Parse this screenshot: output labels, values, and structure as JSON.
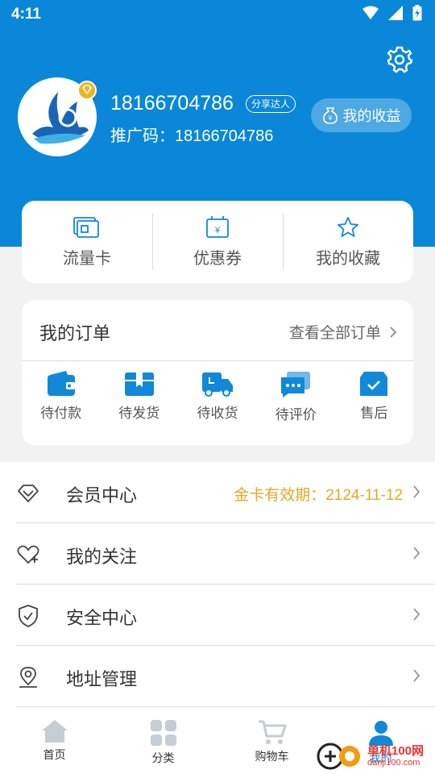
{
  "status": {
    "time": "4:11"
  },
  "profile": {
    "username": "18166704786",
    "badge": "分享达人",
    "promo_label": "推广码：",
    "promo_code": "18166704786",
    "earnings": "我的收益"
  },
  "quick": [
    {
      "label": "流量卡",
      "icon": "sim-card-icon"
    },
    {
      "label": "优惠券",
      "icon": "coupon-icon"
    },
    {
      "label": "我的收藏",
      "icon": "star-icon"
    }
  ],
  "orders": {
    "title": "我的订单",
    "view_all": "查看全部订单",
    "items": [
      {
        "label": "待付款",
        "icon": "wallet-icon"
      },
      {
        "label": "待发货",
        "icon": "package-icon"
      },
      {
        "label": "待收货",
        "icon": "truck-icon"
      },
      {
        "label": "待评价",
        "icon": "chat-icon"
      },
      {
        "label": "售后",
        "icon": "after-sale-icon"
      }
    ]
  },
  "menu": [
    {
      "label": "会员中心",
      "extra": "金卡有效期：2124-11-12",
      "icon": "diamond-icon"
    },
    {
      "label": "我的关注",
      "extra": "",
      "icon": "heart-plus-icon"
    },
    {
      "label": "安全中心",
      "extra": "",
      "icon": "shield-check-icon"
    },
    {
      "label": "地址管理",
      "extra": "",
      "icon": "location-icon"
    }
  ],
  "tabs": [
    {
      "label": "首页",
      "icon": "home-icon"
    },
    {
      "label": "分类",
      "icon": "grid-icon"
    },
    {
      "label": "购物车",
      "icon": "cart-icon"
    },
    {
      "label": "我的",
      "icon": "user-icon"
    }
  ],
  "watermark": {
    "text": "单机100网",
    "sub": "danji100.com"
  },
  "colors": {
    "primary": "#0a87d9",
    "accent": "#1288d8",
    "gold": "#e5a824"
  }
}
